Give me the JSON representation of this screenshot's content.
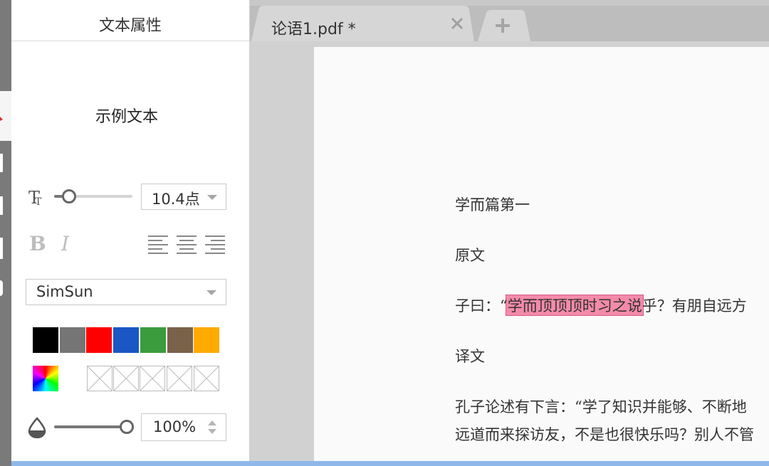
{
  "panel": {
    "title": "文本属性",
    "sample_text": "示例文本",
    "font_size": {
      "value": "10.4点"
    },
    "bold_label": "B",
    "italic_label": "I",
    "font_family": {
      "value": "SimSun"
    },
    "colors": [
      "#000000",
      "#757575",
      "#ff0000",
      "#1a56c4",
      "#3a9c3c",
      "#7a6149",
      "#ffaa00"
    ],
    "opacity": {
      "value": "100%"
    }
  },
  "tabs": [
    {
      "label": "论语1.pdf *"
    }
  ],
  "document": {
    "lines": [
      "学而篇第一",
      "原文",
      "子曰：“学而顶顶顶时习之说乎？有朋自远方",
      "译文",
      "孔子论述有下言：“学了知识并能够、不断地",
      "远道而来探访友，不是也很快乐吗？别人不管"
    ]
  }
}
